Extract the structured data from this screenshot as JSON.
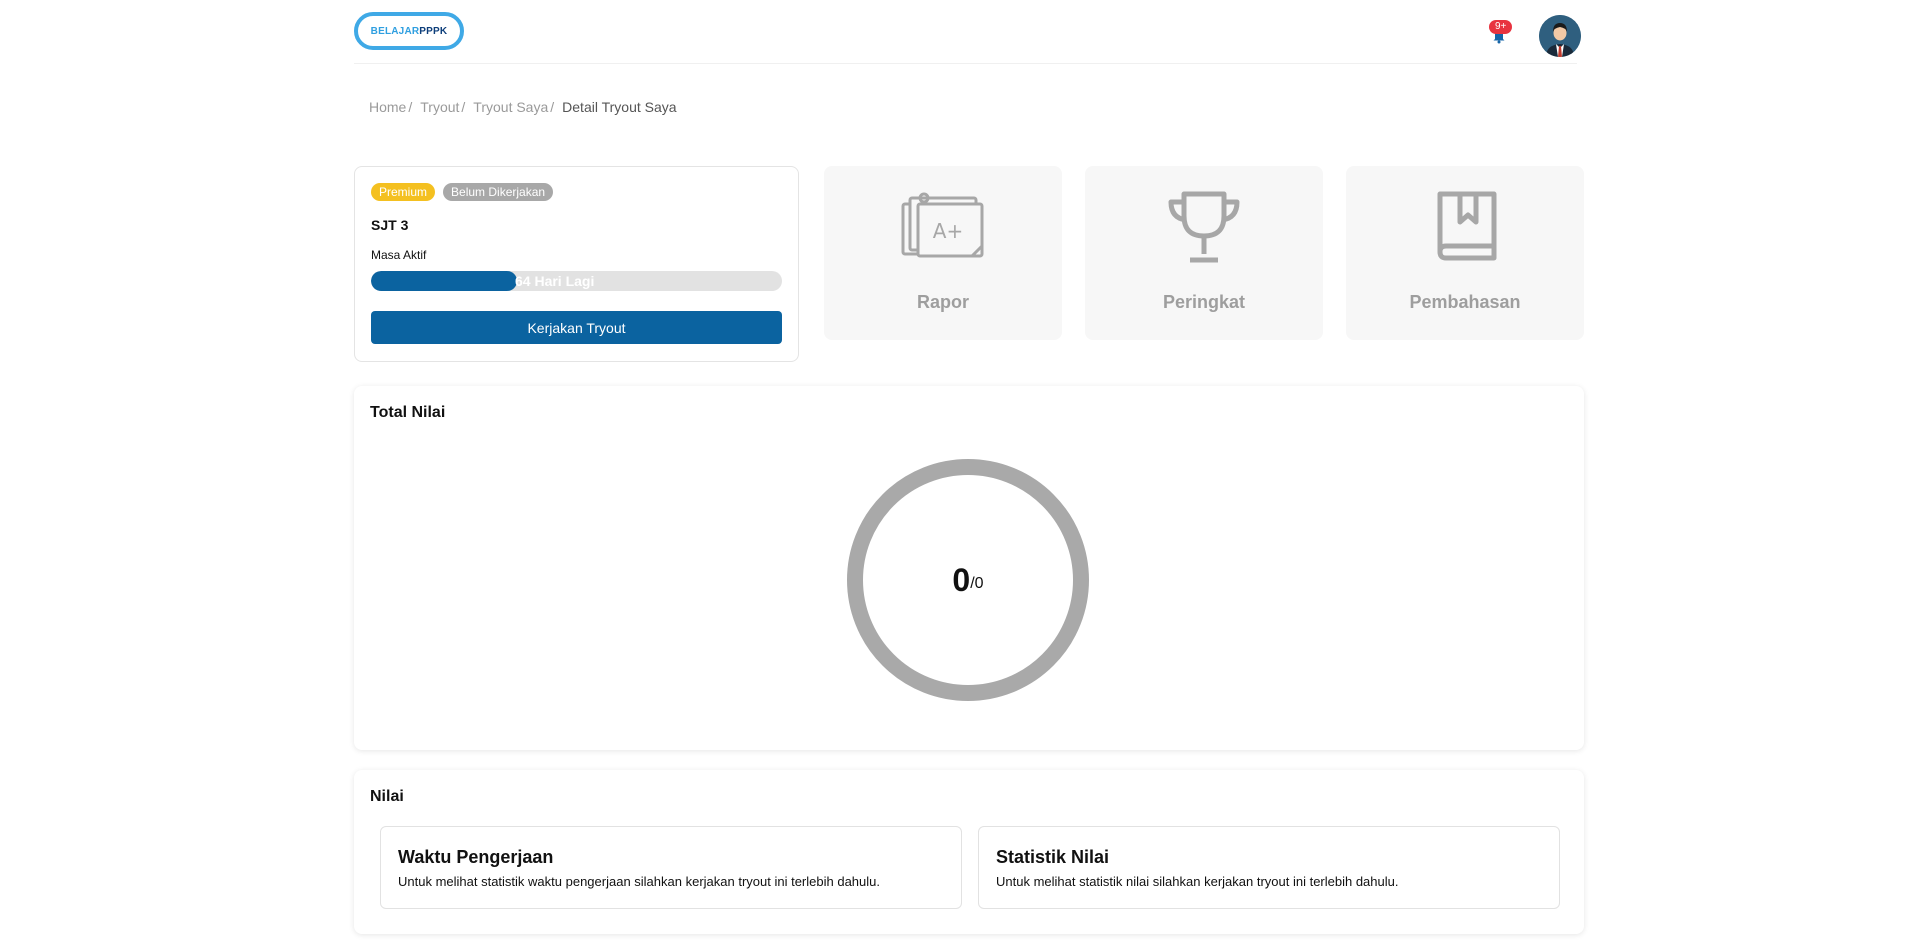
{
  "header": {
    "logo_part1": "BELAJAR",
    "logo_part2": "PPPK",
    "notification_badge": "9+"
  },
  "breadcrumb": {
    "items": [
      "Home",
      "Tryout",
      "Tryout Saya"
    ],
    "current": "Detail Tryout Saya",
    "separator": "/"
  },
  "tryout": {
    "badge_premium": "Premium",
    "badge_status": "Belum Dikerjakan",
    "title": "SJT 3",
    "masa_label": "Masa Aktif",
    "remaining_label": "64 Hari Lagi",
    "progress_fraction": 0.355,
    "cta_label": "Kerjakan Tryout"
  },
  "features": {
    "rapor": {
      "label": "Rapor",
      "icon": "report-card-icon"
    },
    "peringkat": {
      "label": "Peringkat",
      "icon": "trophy-icon"
    },
    "pembahasan": {
      "label": "Pembahasan",
      "icon": "bookmark-book-icon"
    }
  },
  "total_nilai": {
    "title": "Total Nilai",
    "score": "0",
    "max": "/0"
  },
  "nilai": {
    "title": "Nilai",
    "waktu": {
      "heading": "Waktu Pengerjaan",
      "text": "Untuk melihat statistik waktu pengerjaan silahkan kerjakan tryout ini terlebih dahulu."
    },
    "statistik": {
      "heading": "Statistik Nilai",
      "text": "Untuk melihat statistik nilai silahkan kerjakan tryout ini terlebih dahulu."
    }
  },
  "colors": {
    "primary": "#0b63a0",
    "premium": "#f4c020",
    "status": "#a8a8a8",
    "muted": "#9e9e9e",
    "badge_red": "#e8333f"
  }
}
